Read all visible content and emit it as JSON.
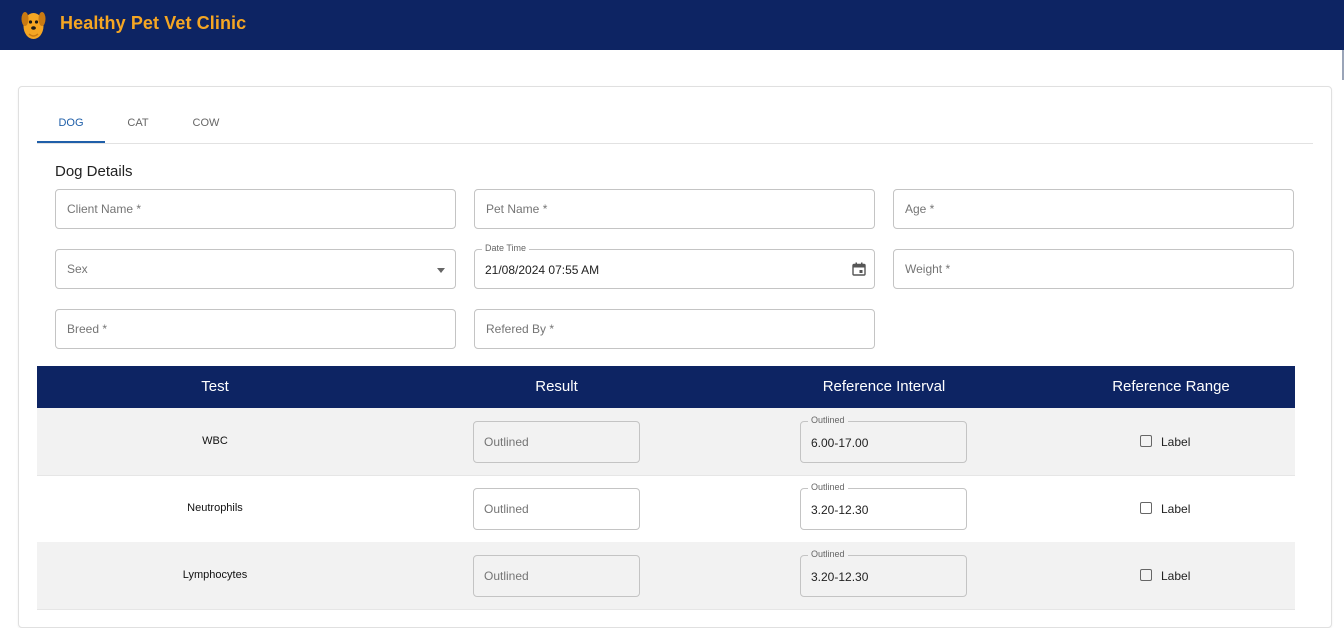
{
  "app": {
    "title": "Healthy Pet Vet Clinic",
    "colors": {
      "appbar": "#0d2463",
      "brand": "#f5a623",
      "accent": "#1f5fa9"
    }
  },
  "tabs": [
    {
      "label": "DOG",
      "active": true
    },
    {
      "label": "CAT",
      "active": false
    },
    {
      "label": "COW",
      "active": false
    }
  ],
  "form": {
    "title": "Dog Details",
    "client_name": {
      "placeholder": "Client Name *"
    },
    "pet_name": {
      "placeholder": "Pet Name *"
    },
    "age": {
      "placeholder": "Age *"
    },
    "sex": {
      "placeholder": "Sex"
    },
    "date_time": {
      "label": "Date Time",
      "value": "21/08/2024 07:55 AM"
    },
    "weight": {
      "placeholder": "Weight *"
    },
    "breed": {
      "placeholder": "Breed *"
    },
    "refered_by": {
      "placeholder": "Refered By *"
    }
  },
  "table": {
    "headers": [
      "Test",
      "Result",
      "Reference Interval",
      "Reference Range"
    ],
    "rows": [
      {
        "test": "WBC",
        "result_placeholder": "Outlined",
        "interval_label": "Outlined",
        "interval_value": "6.00-17.00",
        "checkbox_label": "Label"
      },
      {
        "test": "Neutrophils",
        "result_placeholder": "Outlined",
        "interval_label": "Outlined",
        "interval_value": "3.20-12.30",
        "checkbox_label": "Label"
      },
      {
        "test": "Lymphocytes",
        "result_placeholder": "Outlined",
        "interval_label": "Outlined",
        "interval_value": "3.20-12.30",
        "checkbox_label": "Label"
      }
    ]
  }
}
